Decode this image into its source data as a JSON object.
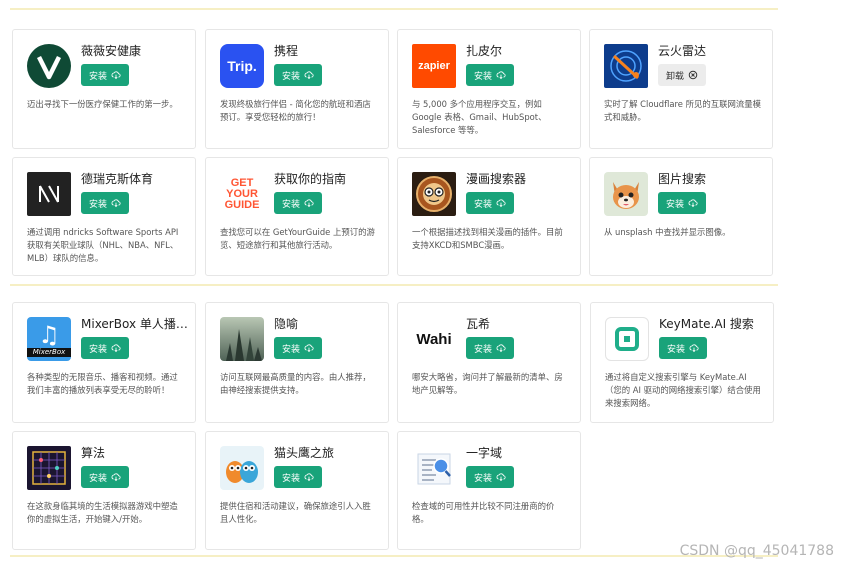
{
  "colors": {
    "install_bg": "#19a37a",
    "divider": "#f6efc4"
  },
  "buttons": {
    "install": "安装",
    "uninstall": "卸载"
  },
  "section1": [
    {
      "name": "薇薇安健康",
      "button": "install",
      "desc": "迈出寻找下一份医疗保健工作的第一步。",
      "icon": "vivian-health-logo"
    },
    {
      "name": "携程",
      "button": "install",
      "desc": "发现终极旅行伴侣 - 简化您的航班和酒店预订。享受您轻松的旅行！",
      "icon": "trip-logo",
      "logo_text": "Trip."
    },
    {
      "name": "扎皮尔",
      "button": "install",
      "desc": "与 5,000 多个应用程序交互，例如 Google 表格、Gmail、HubSpot、Salesforce 等等。",
      "icon": "zapier-logo",
      "logo_text": "zapier"
    },
    {
      "name": "云火雷达",
      "button": "uninstall",
      "desc": "实时了解 Cloudflare 所见的互联网流量模式和威胁。",
      "icon": "cloudflare-radar-logo"
    },
    {
      "name": "德瑞克斯体育",
      "button": "install",
      "desc": "通过调用 ndricks Software Sports API 获取有关职业球队（NHL、NBA、NFL、MLB）球队的信息。",
      "icon": "ndricks-logo"
    },
    {
      "name": "获取你的指南",
      "button": "install",
      "desc": "查找您可以在 GetYourGuide 上预订的游览、短途旅行和其他旅行活动。",
      "icon": "getyourguide-logo",
      "logo_text": "GET YOUR GUIDE"
    },
    {
      "name": "漫画搜索器",
      "button": "install",
      "desc": "一个根据描述找到相关漫画的插件。目前支持XKCD和SMBC漫画。",
      "icon": "comic-logo"
    },
    {
      "name": "图片搜索",
      "button": "install",
      "desc": "从 unsplash 中查找并显示图像。",
      "icon": "dog-logo"
    }
  ],
  "section2": [
    {
      "name": "MixerBox 单人播放...",
      "button": "install",
      "desc": "各种类型的无限音乐、播客和视频。通过我们丰富的播放列表享受无尽的聆听！",
      "icon": "mixerbox-logo",
      "logo_text": "MixerBox"
    },
    {
      "name": "隐喻",
      "button": "install",
      "desc": "访问互联网最高质量的内容。由人推荐，由神经搜索提供支持。",
      "icon": "metaphor-logo"
    },
    {
      "name": "瓦希",
      "button": "install",
      "desc": "哪安大略省，询问并了解最新的清单、房地产见解等。",
      "icon": "wahi-logo",
      "logo_text": "Wahi"
    },
    {
      "name": "KeyMate.AI 搜索",
      "button": "install",
      "desc": "通过将自定义搜索引擎与 KeyMate.AI（您的 AI 驱动的网络搜索引擎）结合使用来搜索网络。",
      "icon": "keymate-logo"
    },
    {
      "name": "算法",
      "button": "install",
      "desc": "在这款身临其境的生活模拟器游戏中塑造你的虚拟生活，开始键入/开始。",
      "icon": "algorithm-logo"
    },
    {
      "name": "猫头鹰之旅",
      "button": "install",
      "desc": "提供住宿和活动建议，确保旅途引人入胜且人性化。",
      "icon": "owl-logo"
    },
    {
      "name": "一字域",
      "button": "install",
      "desc": "检查域的可用性并比较不同注册商的价格。",
      "icon": "domain-logo"
    }
  ],
  "watermark": "CSDN @qq_45041788"
}
